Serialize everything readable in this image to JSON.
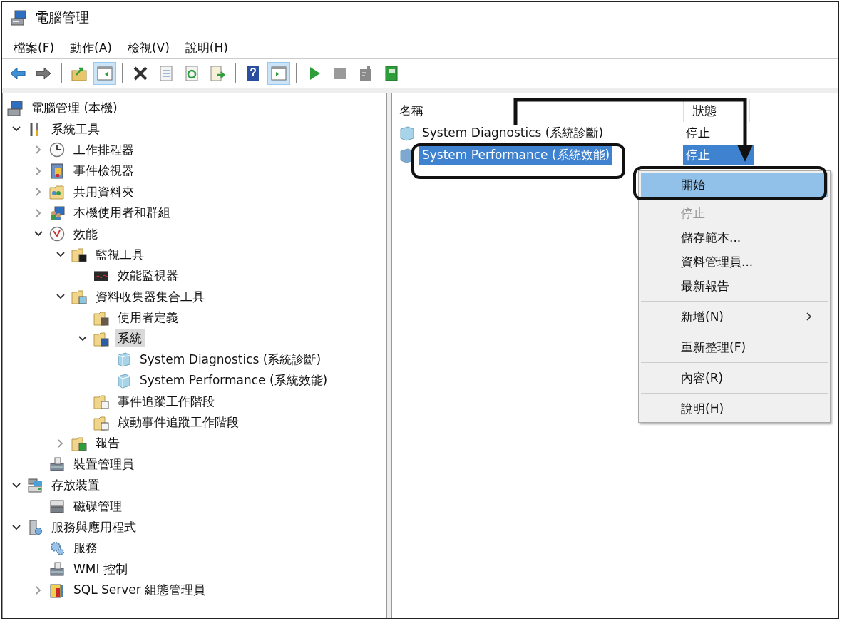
{
  "window": {
    "title": "電腦管理"
  },
  "menu_bar": [
    {
      "label": "檔案(F)"
    },
    {
      "label": "動作(A)"
    },
    {
      "label": "檢視(V)"
    },
    {
      "label": "說明(H)"
    }
  ],
  "toolbar": [
    {
      "kind": "back",
      "pressed": false
    },
    {
      "kind": "forward",
      "pressed": false
    },
    {
      "kind": "separator"
    },
    {
      "kind": "up-folder",
      "pressed": false
    },
    {
      "kind": "tree-pane",
      "pressed": true
    },
    {
      "kind": "separator"
    },
    {
      "kind": "delete",
      "pressed": false
    },
    {
      "kind": "properties",
      "pressed": false
    },
    {
      "kind": "refresh",
      "pressed": false
    },
    {
      "kind": "export",
      "pressed": false
    },
    {
      "kind": "separator"
    },
    {
      "kind": "help",
      "pressed": false
    },
    {
      "kind": "action-pane",
      "pressed": true
    },
    {
      "kind": "separator"
    },
    {
      "kind": "play",
      "pressed": false
    },
    {
      "kind": "stop",
      "pressed": false
    },
    {
      "kind": "document",
      "pressed": false
    },
    {
      "kind": "book",
      "pressed": false
    }
  ],
  "tree": {
    "label": "電腦管理 (本機)",
    "kind": "computer",
    "selected": false,
    "children": [
      {
        "label": "系統工具",
        "kind": "tools",
        "expanded": true,
        "selected": false,
        "children": [
          {
            "label": "工作排程器",
            "kind": "clock",
            "expanded": false,
            "selected": false
          },
          {
            "label": "事件檢視器",
            "kind": "log",
            "expanded": false,
            "selected": false
          },
          {
            "label": "共用資料夾",
            "kind": "shared",
            "expanded": false,
            "selected": false
          },
          {
            "label": "本機使用者和群組",
            "kind": "users",
            "expanded": false,
            "selected": false
          },
          {
            "label": "效能",
            "kind": "gauge",
            "expanded": true,
            "selected": false,
            "children": [
              {
                "label": "監視工具",
                "kind": "folder-chart",
                "expanded": true,
                "selected": false,
                "children": [
                  {
                    "label": "效能監視器",
                    "kind": "monitor",
                    "selected": false
                  }
                ]
              },
              {
                "label": "資料收集器集合工具",
                "kind": "folder-cube",
                "expanded": true,
                "selected": false,
                "children": [
                  {
                    "label": "使用者定義",
                    "kind": "folder-user",
                    "selected": false
                  },
                  {
                    "label": "系統",
                    "kind": "folder-blue",
                    "expanded": true,
                    "selected": true,
                    "children": [
                      {
                        "label": "System Diagnostics (系統診斷)",
                        "kind": "cube",
                        "selected": false
                      },
                      {
                        "label": "System Performance (系統效能)",
                        "kind": "cube",
                        "selected": false
                      }
                    ]
                  },
                  {
                    "label": "事件追蹤工作階段",
                    "kind": "folder-doc",
                    "selected": false
                  },
                  {
                    "label": "啟動事件追蹤工作階段",
                    "kind": "folder-doc",
                    "selected": false
                  }
                ]
              },
              {
                "label": "報告",
                "kind": "folder-green",
                "expanded": false,
                "selected": false
              }
            ]
          },
          {
            "label": "裝置管理員",
            "kind": "device",
            "selected": false
          }
        ]
      },
      {
        "label": "存放裝置",
        "kind": "storage",
        "expanded": true,
        "selected": false,
        "children": [
          {
            "label": "磁碟管理",
            "kind": "disk",
            "selected": false
          }
        ]
      },
      {
        "label": "服務與應用程式",
        "kind": "server",
        "expanded": true,
        "selected": false,
        "children": [
          {
            "label": "服務",
            "kind": "gear",
            "selected": false
          },
          {
            "label": "WMI 控制",
            "kind": "device",
            "selected": false
          },
          {
            "label": "SQL Server 組態管理員",
            "kind": "sql",
            "expanded": false,
            "selected": false
          }
        ]
      }
    ]
  },
  "list": {
    "columns": [
      "名稱",
      "狀態"
    ],
    "rows": [
      {
        "name": "System Diagnostics (系統診斷)",
        "status": "停止",
        "selected": false
      },
      {
        "name": "System Performance (系統效能)",
        "status": "停止",
        "selected": true
      }
    ]
  },
  "context_menu": {
    "groups": [
      [
        {
          "label": "開始",
          "highlighted": true,
          "disabled": false,
          "submenu": false
        },
        {
          "label": "停止",
          "highlighted": false,
          "disabled": true,
          "submenu": false
        },
        {
          "label": "儲存範本...",
          "highlighted": false,
          "disabled": false,
          "submenu": false
        },
        {
          "label": "資料管理員...",
          "highlighted": false,
          "disabled": false,
          "submenu": false
        },
        {
          "label": "最新報告",
          "highlighted": false,
          "disabled": false,
          "submenu": false
        }
      ],
      [
        {
          "label": "新增(N)",
          "highlighted": false,
          "disabled": false,
          "submenu": true
        }
      ],
      [
        {
          "label": "重新整理(F)",
          "highlighted": false,
          "disabled": false,
          "submenu": false
        }
      ],
      [
        {
          "label": "內容(R)",
          "highlighted": false,
          "disabled": false,
          "submenu": false
        }
      ],
      [
        {
          "label": "說明(H)",
          "highlighted": false,
          "disabled": false,
          "submenu": false
        }
      ]
    ]
  }
}
